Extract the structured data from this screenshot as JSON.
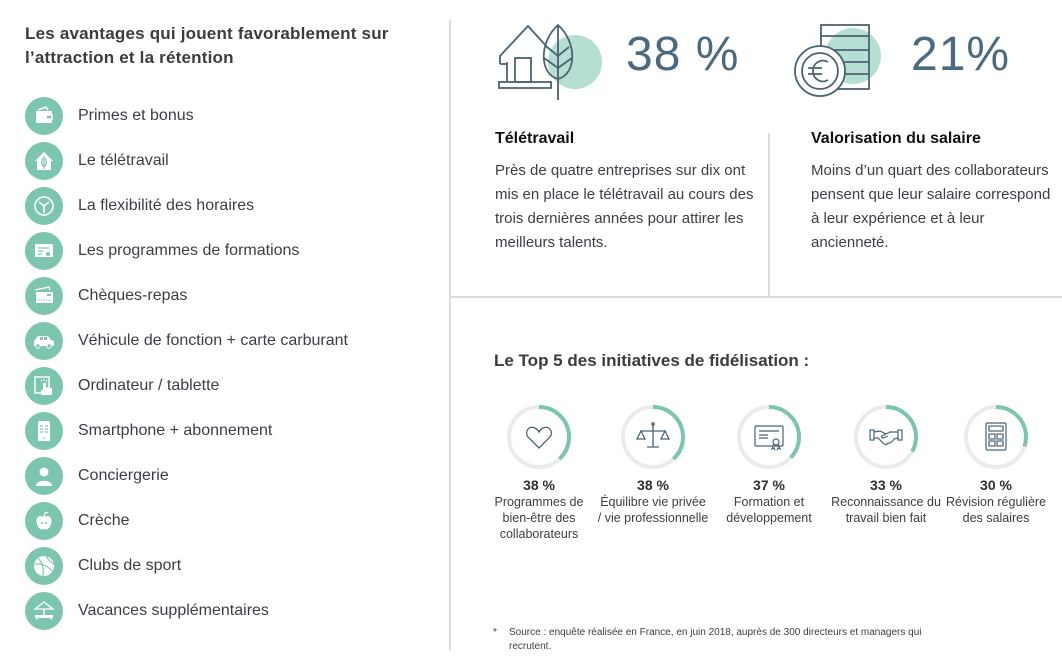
{
  "left_panel": {
    "title": "Les avantages qui jouent favorablement sur l’attraction et la rétention",
    "icon_color": "#7cc5ae",
    "perks": [
      {
        "label": "Primes et bonus",
        "icon": "wallet-icon"
      },
      {
        "label": "Le télétravail",
        "icon": "house-leaf-icon"
      },
      {
        "label": "La flexibilité des horaires",
        "icon": "clock-icon"
      },
      {
        "label": "Les programmes de formations",
        "icon": "certificate-icon"
      },
      {
        "label": "Chèques-repas",
        "icon": "cards-icon"
      },
      {
        "label": "Véhicule de fonction + carte carburant",
        "icon": "car-icon"
      },
      {
        "label": "Ordinateur / tablette",
        "icon": "tablet-touch-icon"
      },
      {
        "label": "Smartphone + abonnement",
        "icon": "smartphone-icon"
      },
      {
        "label": "Conciergerie",
        "icon": "person-icon"
      },
      {
        "label": "Crèche",
        "icon": "apple-icon"
      },
      {
        "label": "Clubs de sport",
        "icon": "ball-icon"
      },
      {
        "label": "Vacances supplémentaires",
        "icon": "parasol-icon"
      }
    ]
  },
  "stats": [
    {
      "value": "38 %",
      "icon": "house-leaf-icon",
      "title": "Télétravail",
      "text": "Près de quatre entreprises sur dix ont mis en place le télétravail au cours des trois dernières années pour attirer les meilleurs talents."
    },
    {
      "value": "21%",
      "icon": "euro-coins-icon",
      "title": "Valorisation du salaire",
      "text": "Moins d’un quart des collaborateurs pensent que leur salaire correspond à leur expérience et à leur ancienneté."
    }
  ],
  "colors": {
    "accent": "#7cc5ae",
    "accent_light": "#b5dfd2",
    "stat_number": "#4a6a80",
    "ring_track": "#ebebeb",
    "icon_stroke": "#4a6373"
  },
  "top5": {
    "title": "Le Top 5 des initiatives de fidélisation :",
    "items": [
      {
        "pct_label": "38 %",
        "value": 38,
        "label": "Programmes de bien-être des collaborateurs",
        "icon": "heart-icon"
      },
      {
        "pct_label": "38 %",
        "value": 38,
        "label": "Équilibre vie privée / vie professionnelle",
        "icon": "scales-icon"
      },
      {
        "pct_label": "37 %",
        "value": 37,
        "label": "Formation et développement",
        "icon": "certificate-icon"
      },
      {
        "pct_label": "33 %",
        "value": 33,
        "label": "Reconnaissance du travail bien fait",
        "icon": "handshake-icon"
      },
      {
        "pct_label": "30 %",
        "value": 30,
        "label": "Révision régulière des salaires",
        "icon": "calculator-icon"
      }
    ]
  },
  "footnote": {
    "marker": "*",
    "text": "Source : enquête réalisée en France, en juin 2018, auprès de 300 directeurs et managers qui recrutent."
  }
}
